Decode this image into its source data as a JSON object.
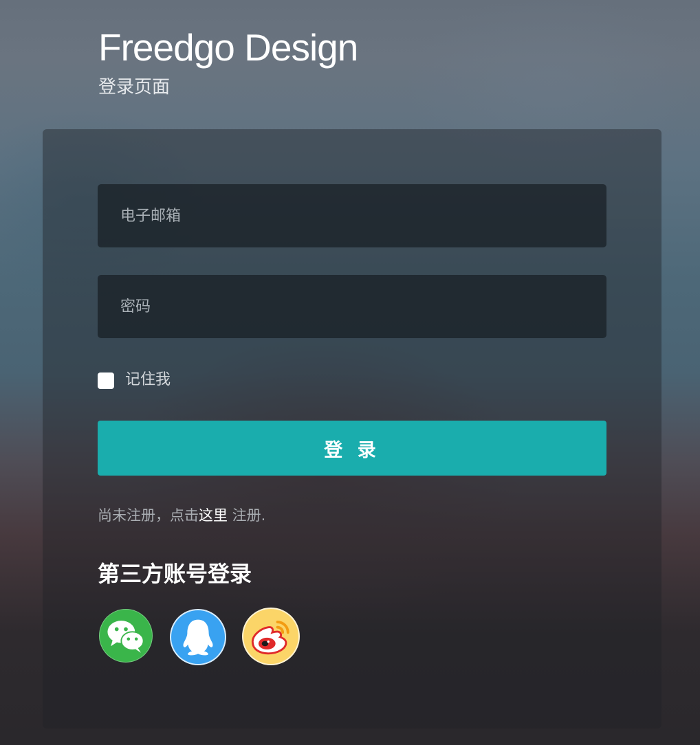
{
  "brand": {
    "title": "Freedgo Design",
    "subtitle": "登录页面"
  },
  "form": {
    "email_placeholder": "电子邮箱",
    "password_placeholder": "密码",
    "remember_label": "记住我",
    "remember_checked": false,
    "login_label": "登 录"
  },
  "register": {
    "prefix": "尚未注册，点击",
    "link_label": "这里",
    "suffix": " 注册."
  },
  "third_party": {
    "title": "第三方账号登录",
    "providers": [
      {
        "name": "wechat",
        "icon": "wechat-icon",
        "color": "#3ab54a"
      },
      {
        "name": "qq",
        "icon": "qq-icon",
        "color": "#39a2f1"
      },
      {
        "name": "weibo",
        "icon": "weibo-icon",
        "color": "#fbd568"
      }
    ]
  },
  "colors": {
    "accent": "#1aadad"
  }
}
